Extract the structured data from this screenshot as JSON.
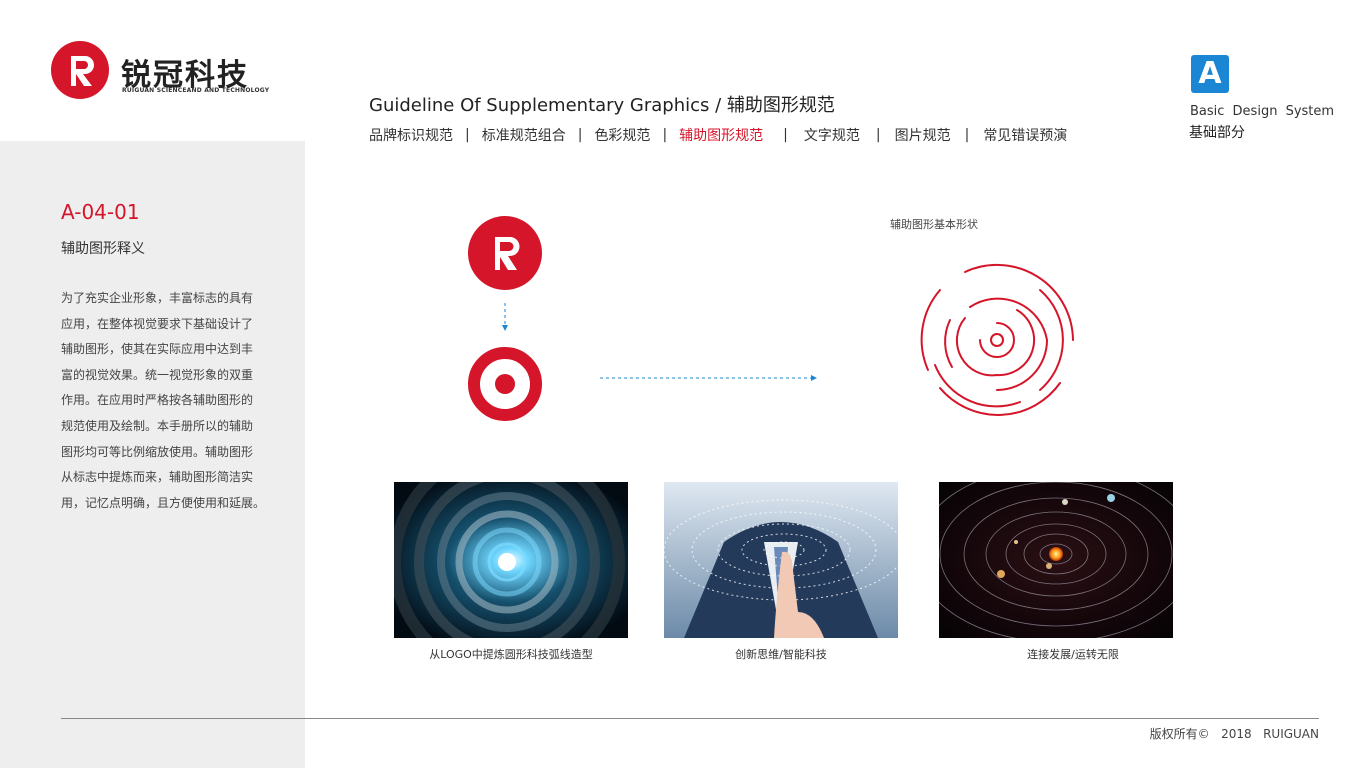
{
  "brand": {
    "name_cn": "锐冠科技",
    "name_en": "RUIGUAN SCIENCEAND AND TECHNOLOGY",
    "color_primary": "#d5152a",
    "color_accent": "#1b86d3"
  },
  "header": {
    "title": "Guideline Of Supplementary Graphics  /  辅助图形规范",
    "nav": [
      {
        "label": "品牌标识规范",
        "active": false
      },
      {
        "label": "标准规范组合",
        "active": false
      },
      {
        "label": "色彩规范",
        "active": false
      },
      {
        "label": "辅助图形规范",
        "active": true
      },
      {
        "label": "文字规范",
        "active": false
      },
      {
        "label": "图片规范",
        "active": false
      },
      {
        "label": "常见错误预演",
        "active": false
      }
    ]
  },
  "badge": {
    "letter": "A",
    "subtitle_en": "Basic Design System",
    "subtitle_cn": "基础部分"
  },
  "section": {
    "code": "A-04-01",
    "title": "辅助图形释义",
    "description_lines": [
      "为了充实企业形象，丰富标志的具有",
      "应用，在整体视觉要求下基础设计了",
      "辅助图形，使其在实际应用中达到丰",
      "富的视觉效果。统一视觉形象的双重",
      "作用。在应用时严格按各辅助图形的",
      "规范使用及绘制。本手册所以的辅助",
      "图形均可等比例缩放使用。辅助图形",
      "从标志中提炼而来，辅助图形简洁实",
      "用，记忆点明确，且方便使用和延展。"
    ]
  },
  "diagram": {
    "shape_caption": "辅助图形基本形状"
  },
  "photos": [
    {
      "caption": "从LOGO中提炼圆形科技弧线造型",
      "icon": "tech-rings-image"
    },
    {
      "caption": "创新思维/智能科技",
      "icon": "touch-screen-image"
    },
    {
      "caption": "连接发展/运转无限",
      "icon": "solar-system-image"
    }
  ],
  "footer": {
    "copyright": "版权所有©   2018   RUIGUAN"
  }
}
